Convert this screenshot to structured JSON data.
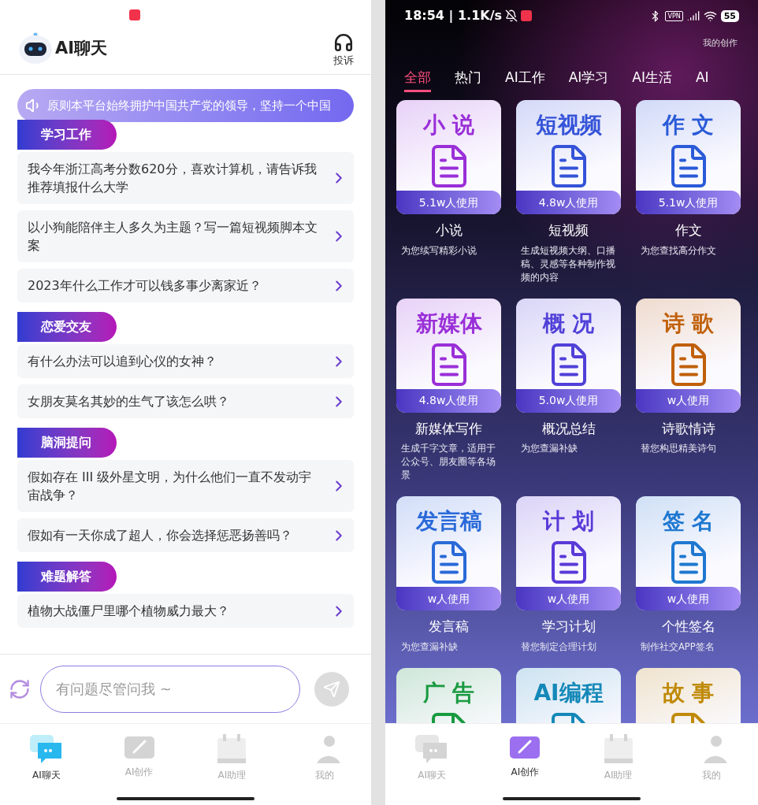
{
  "left": {
    "header": {
      "title": "AI聊天",
      "action": "投诉"
    },
    "notice": "原则本平台始终拥护中国共产党的领导，坚持一个中国",
    "sections": [
      {
        "label": "学习工作",
        "questions": [
          "我今年浙江高考分数620分，喜欢计算机，请告诉我推荐填报什么大学",
          "以小狗能陪伴主人多久为主题？写一篇短视频脚本文案",
          "2023年什么工作才可以钱多事少离家近？"
        ]
      },
      {
        "label": "恋爱交友",
        "questions": [
          "有什么办法可以追到心仪的女神？",
          "女朋友莫名其妙的生气了该怎么哄？"
        ]
      },
      {
        "label": "脑洞提问",
        "questions": [
          "假如存在 III 级外星文明，为什么他们一直不发动宇宙战争？",
          "假如有一天你成了超人，你会选择惩恶扬善吗？"
        ]
      },
      {
        "label": "难题解答",
        "questions": [
          "植物大战僵尸里哪个植物威力最大？"
        ]
      }
    ],
    "input": {
      "placeholder": "有问题尽管问我 ~"
    },
    "nav": [
      {
        "label": "AI聊天",
        "selected": true
      },
      {
        "label": "AI创作",
        "selected": false
      },
      {
        "label": "AI助理",
        "selected": false
      },
      {
        "label": "我的",
        "selected": false
      }
    ]
  },
  "right": {
    "status": {
      "time": "18:54 | 1.1K/s",
      "vpn": "VPN",
      "battery": "55"
    },
    "my_works": "我的创作",
    "tabs": [
      {
        "label": "全部",
        "selected": true
      },
      {
        "label": "热门",
        "selected": false
      },
      {
        "label": "AI工作",
        "selected": false
      },
      {
        "label": "AI学习",
        "selected": false
      },
      {
        "label": "AI生活",
        "selected": false
      },
      {
        "label": "AI",
        "selected": false
      }
    ],
    "tiles": [
      {
        "art_title": "小 说",
        "color": "#9a2fd8",
        "usage": "5.1w人使用",
        "name": "小说",
        "desc": "为您续写精彩小说"
      },
      {
        "art_title": "短视频",
        "color": "#3553d8",
        "usage": "4.8w人使用",
        "name": "短视频",
        "desc": "生成短视频大纲、口播稿、灵感等各种制作视频的内容"
      },
      {
        "art_title": "作 文",
        "color": "#2a5ad8",
        "usage": "5.1w人使用",
        "name": "作文",
        "desc": "为您查找高分作文"
      },
      {
        "art_title": "新媒体",
        "color": "#9a2fd8",
        "usage": "4.8w人使用",
        "name": "新媒体写作",
        "desc": "生成千字文章，适用于公众号、朋友圈等各场景"
      },
      {
        "art_title": "概 况",
        "color": "#5040d8",
        "usage": "5.0w人使用",
        "name": "概况总结",
        "desc": "为您查漏补缺"
      },
      {
        "art_title": "诗 歌",
        "color": "#c0600a",
        "usage": "w人使用",
        "name": "诗歌情诗",
        "desc": "替您构思精美诗句"
      },
      {
        "art_title": "发言稿",
        "color": "#2a6ad8",
        "usage": "w人使用",
        "name": "发言稿",
        "desc": "为您查漏补缺"
      },
      {
        "art_title": "计 划",
        "color": "#5a3ad8",
        "usage": "w人使用",
        "name": "学习计划",
        "desc": "替您制定合理计划"
      },
      {
        "art_title": "签 名",
        "color": "#1f78d0",
        "usage": "w人使用",
        "name": "个性签名",
        "desc": "制作社交APP签名"
      },
      {
        "art_title": "广 告",
        "color": "#1a9a40"
      },
      {
        "art_title": "AI编程",
        "color": "#1488b8"
      },
      {
        "art_title": "故 事",
        "color": "#c08a08"
      }
    ],
    "nav": [
      {
        "label": "AI聊天",
        "selected": false
      },
      {
        "label": "AI创作",
        "selected": true
      },
      {
        "label": "AI助理",
        "selected": false
      },
      {
        "label": "我的",
        "selected": false
      }
    ]
  }
}
